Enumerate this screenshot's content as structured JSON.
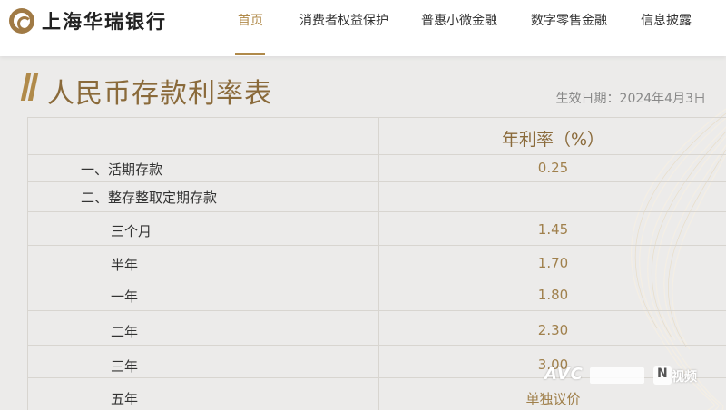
{
  "brand": {
    "name": "上海华瑞银行",
    "accent": "#b08a4a"
  },
  "nav": {
    "items": [
      "首页",
      "消费者权益保护",
      "普惠小微金融",
      "数字零售金融",
      "信息披露"
    ],
    "active_index": 0
  },
  "page": {
    "title": "人民币存款利率表",
    "effective_date": "生效日期：2024年4月3日"
  },
  "table": {
    "header_value": "年利率（%）",
    "rows": [
      {
        "label": "一、活期存款",
        "value": "0.25"
      },
      {
        "label": "二、整存整取定期存款",
        "value": ""
      },
      {
        "label": "三个月",
        "value": "1.45"
      },
      {
        "label": "半年",
        "value": "1.70"
      },
      {
        "label": "一年",
        "value": "1.80"
      },
      {
        "label": "二年",
        "value": "2.30"
      },
      {
        "label": "三年",
        "value": "3.00"
      },
      {
        "label": "五年",
        "value": "单独议价"
      }
    ]
  },
  "watermark": {
    "mark": "AVC",
    "n_letter": "N",
    "label": "视频"
  }
}
